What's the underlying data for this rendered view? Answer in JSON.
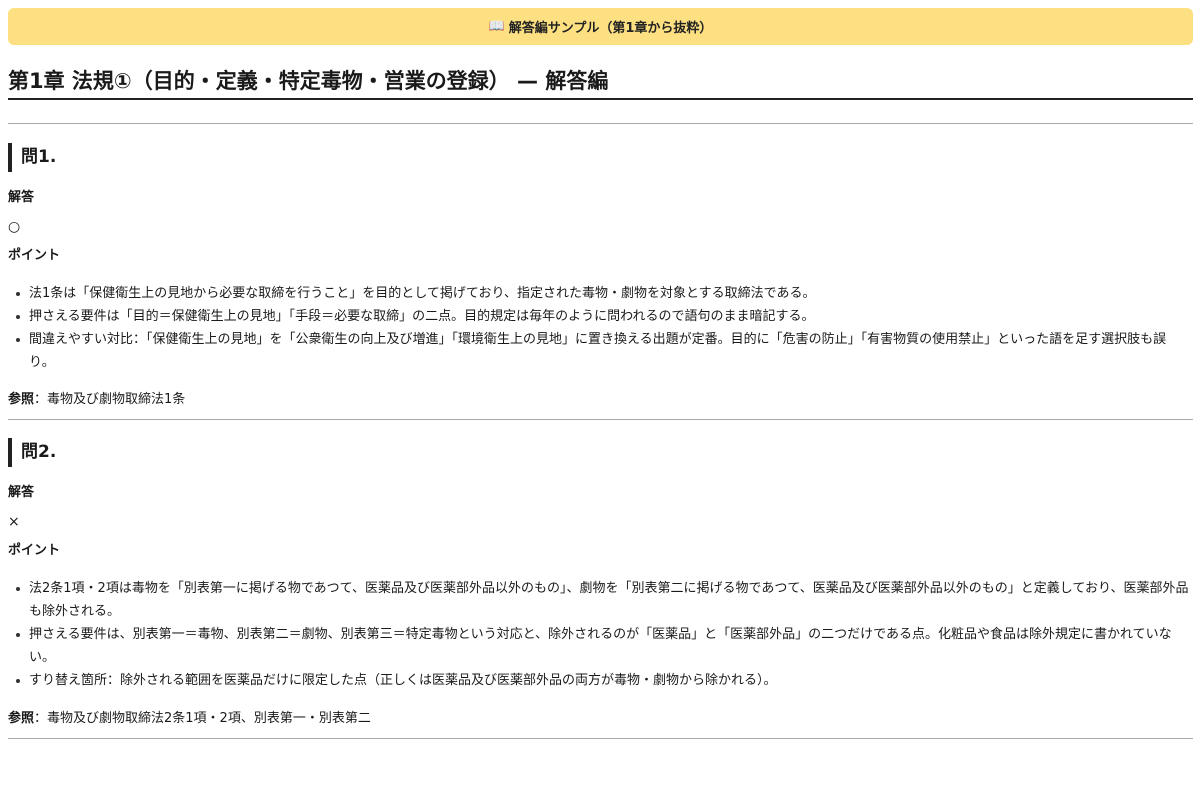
{
  "banner": {
    "icon": "open-book-icon",
    "text": "解答編サンプル（第1章から抜粋）"
  },
  "chapter": {
    "title": "第1章 法規①（目的・定義・特定毒物・営業の登録） — 解答編"
  },
  "questions": [
    {
      "heading": "問1.",
      "answer_label": "解答",
      "answer": "○",
      "points_label": "ポイント",
      "points": [
        "法1条は「保健衛生上の見地から必要な取締を行うこと」を目的として掲げており、指定された毒物・劇物を対象とする取締法である。",
        "押さえる要件は「目的＝保健衛生上の見地」「手段＝必要な取締」の二点。目的規定は毎年のように問われるので語句のまま暗記する。",
        "間違えやすい対比：「保健衛生上の見地」を「公衆衛生の向上及び増進」「環境衛生上の見地」に置き換える出題が定番。目的に「危害の防止」「有害物質の使用禁止」といった語を足す選択肢も誤り。"
      ],
      "ref_label": "参照",
      "ref_text": "：毒物及び劇物取締法1条"
    },
    {
      "heading": "問2.",
      "answer_label": "解答",
      "answer": "×",
      "points_label": "ポイント",
      "points": [
        "法2条1項・2項は毒物を「別表第一に掲げる物であつて、医薬品及び医薬部外品以外のもの」、劇物を「別表第二に掲げる物であつて、医薬品及び医薬部外品以外のもの」と定義しており、医薬部外品も除外される。",
        "押さえる要件は、別表第一＝毒物、別表第二＝劇物、別表第三＝特定毒物という対応と、除外されるのが「医薬品」と「医薬部外品」の二つだけである点。化粧品や食品は除外規定に書かれていない。",
        "すり替え箇所：除外される範囲を医薬品だけに限定した点（正しくは医薬品及び医薬部外品の両方が毒物・劇物から除かれる）。"
      ],
      "ref_label": "参照",
      "ref_text": "：毒物及び劇物取締法2条1項・2項、別表第一・別表第二"
    }
  ]
}
